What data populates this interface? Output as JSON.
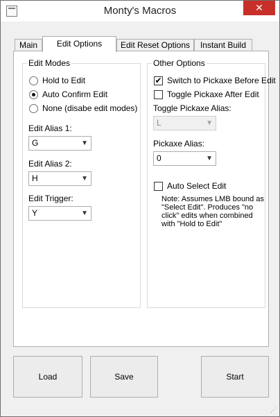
{
  "window": {
    "title": "Monty's Macros",
    "close": "✕"
  },
  "tabs": [
    "Main",
    "Edit Options",
    "Edit Reset Options",
    "Instant Build"
  ],
  "edit_modes": {
    "title": "Edit Modes",
    "options": [
      "Hold to Edit",
      "Auto Confirm Edit",
      "None (disabe edit modes)"
    ],
    "selected": "Auto Confirm Edit",
    "alias1": {
      "label": "Edit Alias 1:",
      "value": "G"
    },
    "alias2": {
      "label": "Edit Alias 2:",
      "value": "H"
    },
    "trigger": {
      "label": "Edit Trigger:",
      "value": "Y"
    }
  },
  "other_options": {
    "title": "Other Options",
    "switch_pickaxe": {
      "label": "Switch to Pickaxe Before Edit",
      "checked": true
    },
    "toggle_pickaxe": {
      "label": "Toggle Pickaxe After Edit",
      "checked": false
    },
    "toggle_alias": {
      "label": "Toggle Pickaxe Alias:",
      "value": "L"
    },
    "pickaxe_alias": {
      "label": "Pickaxe Alias:",
      "value": "0"
    },
    "auto_select": {
      "label": "Auto Select Edit",
      "checked": false
    },
    "note": [
      "Note: Assumes LMB bound as",
      "\"Select Edit\". Produces \"no",
      "click\" edits when combined",
      "with \"Hold to Edit\""
    ]
  },
  "buttons": {
    "load": "Load",
    "save": "Save",
    "start": "Start"
  },
  "icons": {
    "check": "✔",
    "dropdown": "▼",
    "grip": "⋰"
  }
}
